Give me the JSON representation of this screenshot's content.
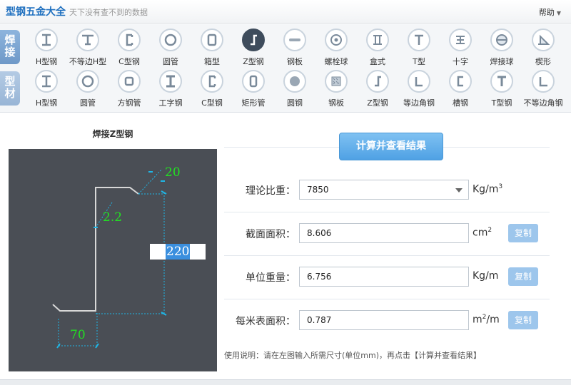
{
  "header": {
    "title": "型钢五金大全",
    "subtitle": "天下没有查不到的数据",
    "help_label": "帮助"
  },
  "categories": {
    "weld": {
      "label_top": "焊",
      "label_bottom": "接"
    },
    "profile": {
      "label_top": "型",
      "label_bottom": "材"
    }
  },
  "weld_items": [
    {
      "label": "H型钢",
      "icon": "h-beam-icon"
    },
    {
      "label": "不等边H型",
      "icon": "unequal-h-beam-icon"
    },
    {
      "label": "C型钢",
      "icon": "c-channel-icon"
    },
    {
      "label": "圆管",
      "icon": "round-tube-icon"
    },
    {
      "label": "箱型",
      "icon": "box-section-icon"
    },
    {
      "label": "Z型钢",
      "icon": "z-section-icon",
      "active": true
    },
    {
      "label": "钢板",
      "icon": "steel-plate-icon"
    },
    {
      "label": "螺栓球",
      "icon": "bolt-ball-icon"
    },
    {
      "label": "盒式",
      "icon": "box-type-icon"
    },
    {
      "label": "T型",
      "icon": "t-section-icon"
    },
    {
      "label": "十字",
      "icon": "cross-section-icon"
    },
    {
      "label": "焊接球",
      "icon": "welded-ball-icon"
    },
    {
      "label": "楔形",
      "icon": "wedge-icon"
    }
  ],
  "profile_items": [
    {
      "label": "H型钢",
      "icon": "h-beam-icon"
    },
    {
      "label": "圆管",
      "icon": "round-tube-icon"
    },
    {
      "label": "方钢管",
      "icon": "square-tube-icon"
    },
    {
      "label": "工字钢",
      "icon": "i-beam-icon"
    },
    {
      "label": "C型钢",
      "icon": "c-channel-icon"
    },
    {
      "label": "矩形管",
      "icon": "rect-tube-icon"
    },
    {
      "label": "圆钢",
      "icon": "round-bar-icon"
    },
    {
      "label": "钢板",
      "icon": "checker-plate-icon"
    },
    {
      "label": "Z型钢",
      "icon": "z-section-icon"
    },
    {
      "label": "等边角钢",
      "icon": "equal-angle-icon"
    },
    {
      "label": "槽钢",
      "icon": "channel-icon"
    },
    {
      "label": "T型钢",
      "icon": "t-beam-icon"
    },
    {
      "label": "不等边角钢",
      "icon": "unequal-angle-icon"
    }
  ],
  "drawing": {
    "title": "焊接Z型钢",
    "dim_top": "20",
    "dim_thickness": "2.2",
    "dim_height": "220",
    "dim_bottom": "70"
  },
  "calc": {
    "button_label": "计算并查看结果",
    "density": {
      "label": "理论比重：",
      "value": "7850",
      "unit": "Kg/m",
      "unit_sup": "3"
    },
    "area": {
      "label": "截面面积：",
      "value": "8.606",
      "unit": "cm",
      "unit_sup": "2",
      "copy": "复制"
    },
    "unit_weight": {
      "label": "单位重量：",
      "value": "6.756",
      "unit": "Kg/m",
      "copy": "复制"
    },
    "surface": {
      "label": "每米表面积：",
      "value": "0.787",
      "unit_prefix": "m",
      "unit_sup": "2",
      "unit_suffix": "/m",
      "copy": "复制"
    },
    "usage": "使用说明：请在左图输入所需尺寸(单位mm)，再点击【计算并查看结果】"
  },
  "colors": {
    "accent": "#4fa1e4",
    "drawing_bg": "#4a4e55",
    "dim_green": "#22e022",
    "dim_cyan": "#1fb6e6"
  }
}
